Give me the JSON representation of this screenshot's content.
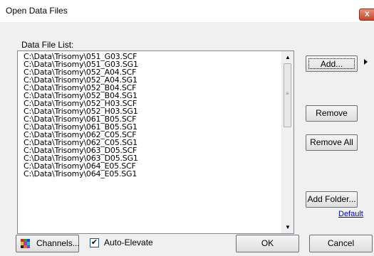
{
  "window": {
    "title": "Open Data Files",
    "close_glyph": "x"
  },
  "list": {
    "label": "Data File List:",
    "items": [
      "C:\\Data\\Trisomy\\051_G03.SCF",
      "C:\\Data\\Trisomy\\051_G03.SG1",
      "C:\\Data\\Trisomy\\052_A04.SCF",
      "C:\\Data\\Trisomy\\052_A04.SG1",
      "C:\\Data\\Trisomy\\052_B04.SCF",
      "C:\\Data\\Trisomy\\052_B04.SG1",
      "C:\\Data\\Trisomy\\052_H03.SCF",
      "C:\\Data\\Trisomy\\052_H03.SG1",
      "C:\\Data\\Trisomy\\061_B05.SCF",
      "C:\\Data\\Trisomy\\061_B05.SG1",
      "C:\\Data\\Trisomy\\062_C05.SCF",
      "C:\\Data\\Trisomy\\062_C05.SG1",
      "C:\\Data\\Trisomy\\063_D05.SCF",
      "C:\\Data\\Trisomy\\063_D05.SG1",
      "C:\\Data\\Trisomy\\064_E05.SCF",
      "C:\\Data\\Trisomy\\064_E05.SG1"
    ]
  },
  "buttons": {
    "add": "Add...",
    "remove": "Remove",
    "remove_all": "Remove All",
    "add_folder": "Add Folder...",
    "default_link": "Default",
    "channels": "Channels...",
    "ok": "OK",
    "cancel": "Cancel"
  },
  "auto_elevate": {
    "label": "Auto-Elevate",
    "checked": true
  },
  "icons": {
    "close": "close-icon",
    "channels": "color-grid-icon",
    "add_menu_arrow": "triangle-right-icon",
    "scroll_up": "chevron-up-icon",
    "scroll_down": "chevron-down-icon"
  },
  "colors": {
    "close_button": "#c9452a",
    "link": "#0000cc",
    "channel_grid": [
      "#d62020",
      "#20a020",
      "#2040d0",
      "#e0c020",
      "#d020d0",
      "#20c0c0",
      "#202020",
      "#e07020",
      "#8040c0"
    ]
  }
}
